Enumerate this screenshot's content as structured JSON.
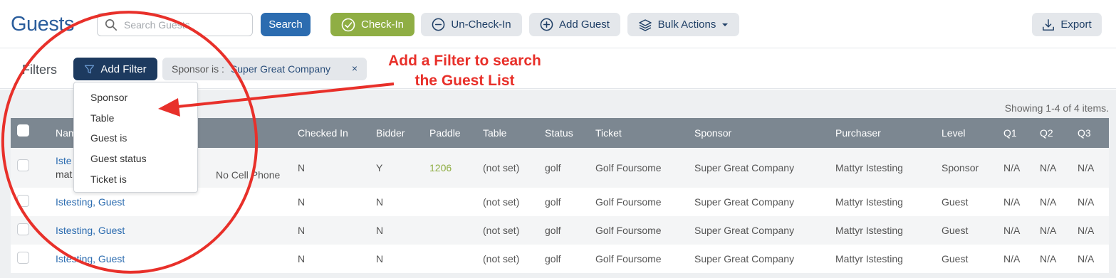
{
  "header": {
    "title": "Guests",
    "search_placeholder": "Search Guests",
    "search_button": "Search",
    "checkin_button": "Check-In",
    "uncheckin_button": "Un-Check-In",
    "add_guest_button": "Add Guest",
    "bulk_actions_button": "Bulk Actions",
    "export_button": "Export"
  },
  "filters": {
    "label": "Filters",
    "add_filter_button": "Add Filter",
    "active_chip": {
      "field": "Sponsor is :",
      "value": "Super Great Company",
      "remove": "×"
    },
    "dropdown_options": [
      "Sponsor",
      "Table",
      "Guest is",
      "Guest status",
      "Ticket is"
    ]
  },
  "summary": "Showing 1-4 of 4 items.",
  "table": {
    "columns": [
      "Nam",
      "Checked In",
      "Bidder",
      "Paddle",
      "Table",
      "Status",
      "Ticket",
      "Sponsor",
      "Purchaser",
      "Level",
      "Q1",
      "Q2",
      "Q3"
    ],
    "rows": [
      {
        "name": "Iste",
        "email": "mat",
        "phone": "No Cell Phone",
        "checked_in": "N",
        "bidder": "Y",
        "paddle": "1206",
        "table": "(not set)",
        "status": "golf",
        "ticket": "Golf Foursome",
        "sponsor": "Super Great Company",
        "purchaser": "Mattyr Istesting",
        "level": "Sponsor",
        "q1": "N/A",
        "q2": "N/A",
        "q3": "N/A"
      },
      {
        "name": "Istesting, Guest",
        "checked_in": "N",
        "bidder": "N",
        "paddle": "",
        "table": "(not set)",
        "status": "golf",
        "ticket": "Golf Foursome",
        "sponsor": "Super Great Company",
        "purchaser": "Mattyr Istesting",
        "level": "Guest",
        "q1": "N/A",
        "q2": "N/A",
        "q3": "N/A"
      },
      {
        "name": "Istesting, Guest",
        "checked_in": "N",
        "bidder": "N",
        "paddle": "",
        "table": "(not set)",
        "status": "golf",
        "ticket": "Golf Foursome",
        "sponsor": "Super Great Company",
        "purchaser": "Mattyr Istesting",
        "level": "Guest",
        "q1": "N/A",
        "q2": "N/A",
        "q3": "N/A"
      },
      {
        "name": "Istesting, Guest",
        "checked_in": "N",
        "bidder": "N",
        "paddle": "",
        "table": "(not set)",
        "status": "golf",
        "ticket": "Golf Foursome",
        "sponsor": "Super Great Company",
        "purchaser": "Mattyr Istesting",
        "level": "Guest",
        "q1": "N/A",
        "q2": "N/A",
        "q3": "N/A"
      }
    ]
  },
  "annotation": {
    "text": "Add a Filter to search the Guest List",
    "color": "#e8302a"
  },
  "colors": {
    "brand_blue": "#2c6cb0",
    "checkin_green": "#8fae44",
    "navy": "#1d3a5f",
    "table_header": "#7c8791"
  },
  "icons": [
    "search-icon",
    "check-circle-icon",
    "minus-circle-icon",
    "plus-circle-icon",
    "layers-icon",
    "caret-down-icon",
    "download-icon",
    "filter-icon",
    "close-icon"
  ]
}
